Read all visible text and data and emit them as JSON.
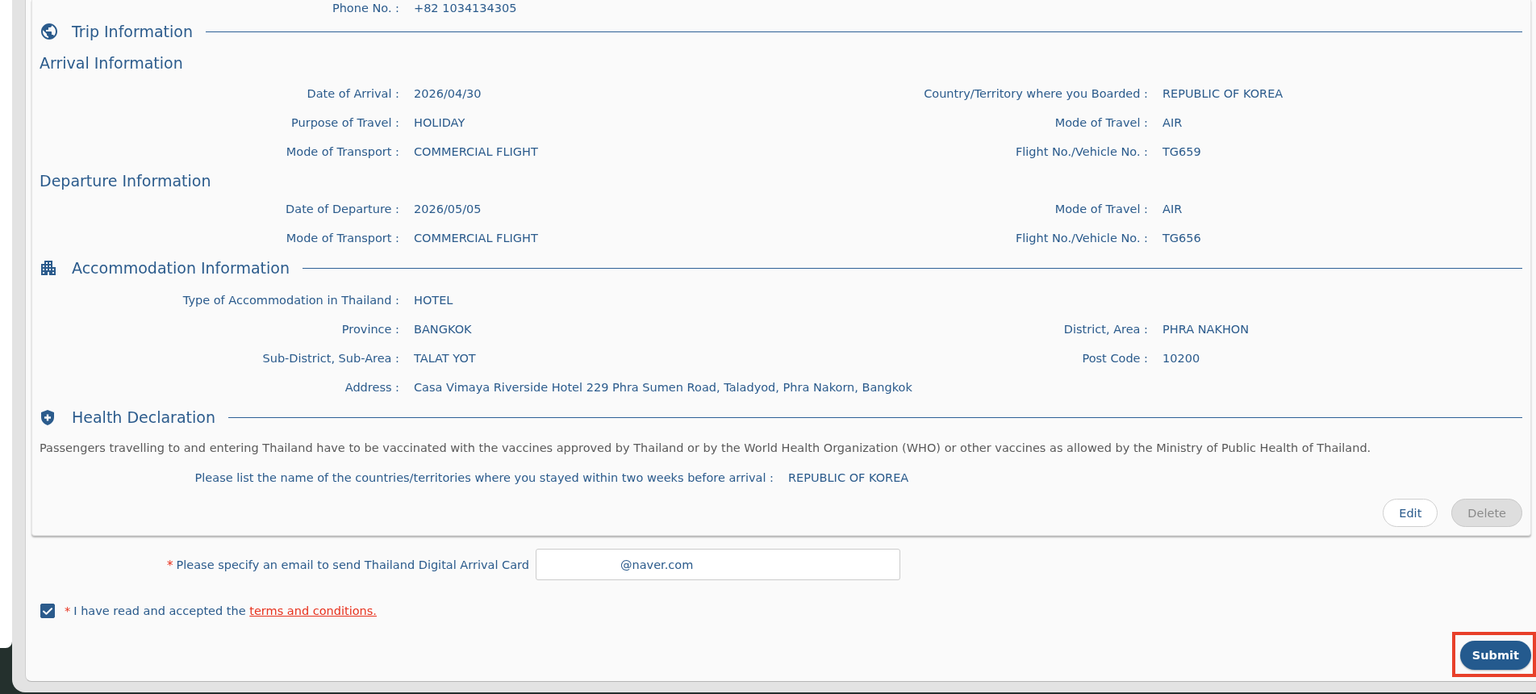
{
  "contact": {
    "label": "Phone No. :",
    "value": "+82 1034134305"
  },
  "trip_information": {
    "title": "Trip Information",
    "groups": [
      {
        "title": "Arrival Information",
        "rows": [
          [
            {
              "label": "Date of Arrival :",
              "value": "2026/04/30"
            },
            {
              "label": "Country/Territory where you Boarded :",
              "value": "REPUBLIC OF KOREA"
            }
          ],
          [
            {
              "label": "Purpose of Travel :",
              "value": "HOLIDAY"
            },
            {
              "label": "Mode of Travel :",
              "value": "AIR"
            }
          ],
          [
            {
              "label": "Mode of Transport :",
              "value": "COMMERCIAL FLIGHT"
            },
            {
              "label": "Flight No./Vehicle No. :",
              "value": "TG659"
            }
          ]
        ]
      },
      {
        "title": "Departure Information",
        "rows": [
          [
            {
              "label": "Date of Departure :",
              "value": "2026/05/05"
            },
            {
              "label": "Mode of Travel :",
              "value": "AIR"
            }
          ],
          [
            {
              "label": "Mode of Transport :",
              "value": "COMMERCIAL FLIGHT"
            },
            {
              "label": "Flight No./Vehicle No. :",
              "value": "TG656"
            }
          ]
        ]
      }
    ]
  },
  "accommodation_information": {
    "title": "Accommodation Information",
    "rows": [
      [
        {
          "label": "Type of Accommodation in Thailand :",
          "value": "HOTEL"
        }
      ],
      [
        {
          "label": "Province :",
          "value": "BANGKOK"
        },
        {
          "label": "District, Area :",
          "value": "PHRA NAKHON"
        }
      ],
      [
        {
          "label": "Sub-District, Sub-Area :",
          "value": "TALAT YOT"
        },
        {
          "label": "Post Code :",
          "value": "10200"
        }
      ],
      [
        {
          "label": "Address :",
          "value": "Casa Vimaya Riverside Hotel 229 Phra Sumen Road, Taladyod, Phra Nakorn, Bangkok"
        }
      ]
    ]
  },
  "health_declaration": {
    "title": "Health Declaration",
    "notice": "Passengers travelling to and entering Thailand have to be vaccinated with the vaccines approved by Thailand or by the World Health Organization (WHO) or other vaccines as allowed by the Ministry of Public Health of Thailand.",
    "question": {
      "label": "Please list the name of the countries/territories where you stayed within two weeks before arrival :",
      "value": "REPUBLIC OF KOREA"
    }
  },
  "card_actions": [
    {
      "label": "Edit",
      "disabled": false
    },
    {
      "label": "Delete",
      "disabled": true
    }
  ],
  "email": {
    "required_mark": "*",
    "label": "Please specify an email to send Thailand Digital Arrival Card",
    "value": "@naver.com"
  },
  "terms": {
    "checked": true,
    "required_mark": "*",
    "text": "I have read and accepted the",
    "link": "terms and conditions."
  },
  "submit_button": {
    "label": "Submit",
    "highlighted": true
  }
}
